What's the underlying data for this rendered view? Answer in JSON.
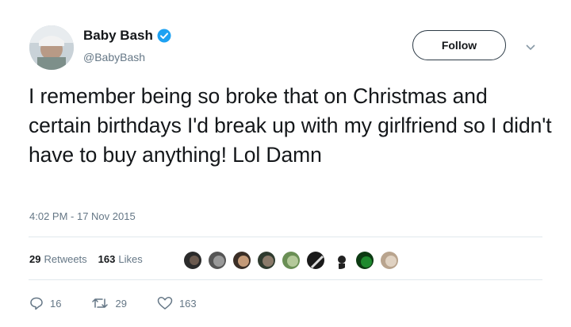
{
  "user": {
    "display_name": "Baby Bash",
    "handle": "@BabyBash",
    "verified": true
  },
  "follow_button": {
    "label": "Follow"
  },
  "tweet": {
    "text": "I remember being so broke that on Christmas and certain birthdays I'd break up with my girlfriend so I didn't have to buy anything! Lol Damn",
    "timestamp": "4:02 PM - 17 Nov 2015"
  },
  "stats": {
    "retweets_count": "29",
    "retweets_label": "Retweets",
    "likes_count": "163",
    "likes_label": "Likes"
  },
  "actions": {
    "reply_count": "16",
    "retweet_count": "29",
    "like_count": "163"
  },
  "colors": {
    "text": "#14171a",
    "muted": "#657786",
    "verified": "#1da1f2",
    "divider": "#e1e8ed"
  },
  "likers": [
    {
      "icon": "avatar-icon"
    },
    {
      "icon": "avatar-icon"
    },
    {
      "icon": "avatar-icon"
    },
    {
      "icon": "avatar-icon"
    },
    {
      "icon": "avatar-icon"
    },
    {
      "icon": "avatar-icon"
    },
    {
      "icon": "avatar-icon"
    },
    {
      "icon": "avatar-icon"
    },
    {
      "icon": "avatar-icon"
    }
  ]
}
